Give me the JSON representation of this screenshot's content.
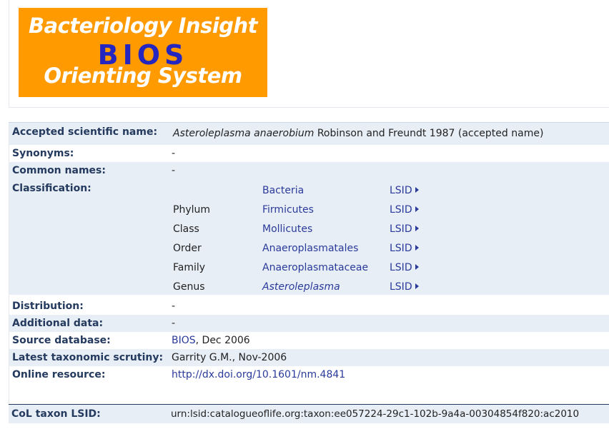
{
  "logo": {
    "line1": "Bacteriology Insight",
    "line2": "BIOS",
    "line3": "Orienting System"
  },
  "record": {
    "accepted_label": "Accepted scientific name:",
    "accepted_genus_species": "Asteroleplasma anaerobium",
    "accepted_author": "Robinson and Freundt 1987 (accepted name)",
    "synonyms_label": "Synonyms:",
    "synonyms_value": "-",
    "common_label": "Common names:",
    "common_value": "-",
    "classification_label": "Classification:",
    "classification": [
      {
        "rank": "",
        "taxon": "Bacteria",
        "italic": false,
        "lsid": "LSID"
      },
      {
        "rank": "Phylum",
        "taxon": "Firmicutes",
        "italic": false,
        "lsid": "LSID"
      },
      {
        "rank": "Class",
        "taxon": "Mollicutes",
        "italic": false,
        "lsid": "LSID"
      },
      {
        "rank": "Order",
        "taxon": "Anaeroplasmatales",
        "italic": false,
        "lsid": "LSID"
      },
      {
        "rank": "Family",
        "taxon": "Anaeroplasmataceae",
        "italic": false,
        "lsid": "LSID"
      },
      {
        "rank": "Genus",
        "taxon": "Asteroleplasma",
        "italic": true,
        "lsid": "LSID"
      }
    ],
    "distribution_label": "Distribution:",
    "distribution_value": "-",
    "additional_label": "Additional data:",
    "additional_value": "-",
    "source_label": "Source database:",
    "source_link": "BIOS",
    "source_date": ", Dec 2006",
    "scrutiny_label": "Latest taxonomic scrutiny:",
    "scrutiny_value": "Garrity G.M., Nov-2006",
    "online_label": "Online resource:",
    "online_link": "http://dx.doi.org/10.1601/nm.4841",
    "col_lsid_label": "CoL taxon LSID:",
    "col_lsid_value": "urn:lsid:catalogueoflife.org:taxon:ee057224-29c1-102b-9a4a-00304854f820:ac2010"
  },
  "colors": {
    "logo_bg": "#ff9a00",
    "logo_accent": "#2525c0",
    "link": "#2a3a9a",
    "row_shade": "#e8eef6",
    "label": "#243a5e"
  }
}
